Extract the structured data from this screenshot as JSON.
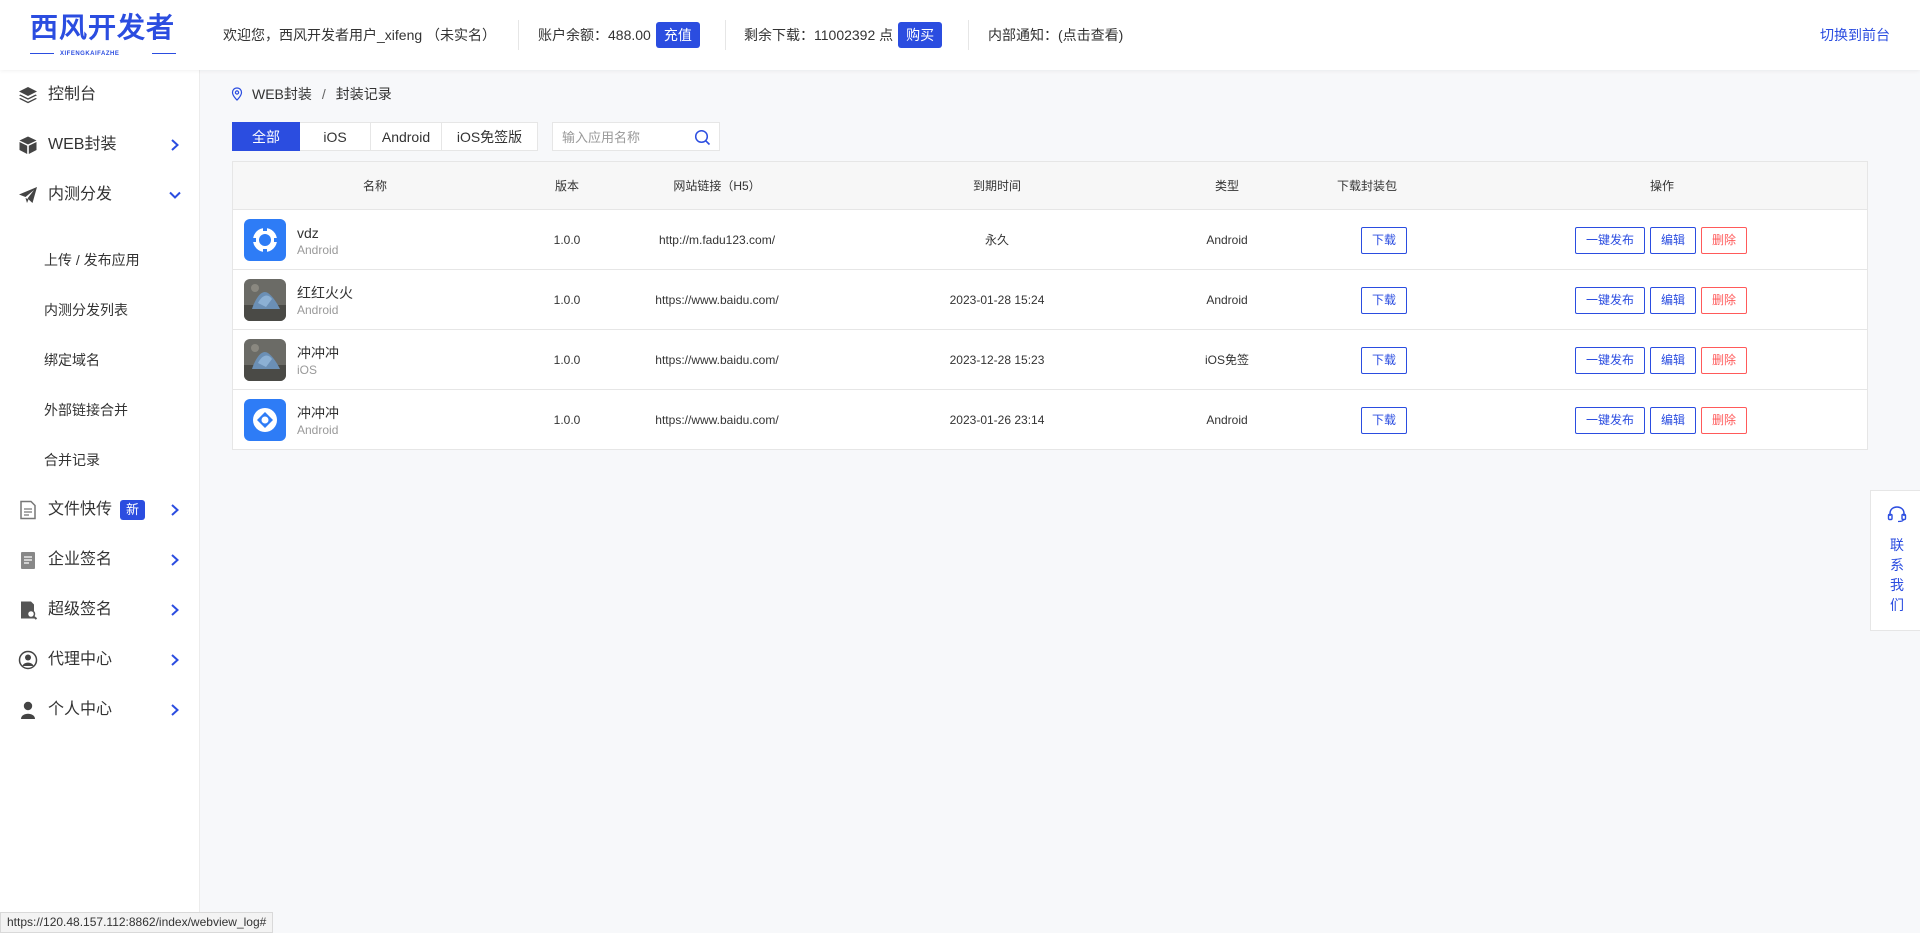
{
  "header": {
    "logo_cn": "西风开发者",
    "logo_en": "XIFENGKAIFAZHE",
    "welcome": "欢迎您，西风开发者用户_xifeng （未实名）",
    "balance_label": "账户余额：488.00",
    "recharge_button": "充值",
    "downloads_label": "剩余下载：11002392 点",
    "buy_button": "购买",
    "notice": "内部通知：(点击查看)",
    "switch_link": "切换到前台"
  },
  "sidebar": {
    "items": [
      {
        "label": "控制台",
        "icon": "layers-icon"
      },
      {
        "label": "WEB封装",
        "icon": "box-icon"
      },
      {
        "label": "内测分发",
        "icon": "paper-plane-icon"
      }
    ],
    "sub_items": [
      "上传 / 发布应用",
      "内测分发列表",
      "绑定域名",
      "外部链接合并",
      "合并记录"
    ],
    "bottom_items": [
      {
        "label": "文件快传",
        "icon": "file-transfer-icon",
        "badge": "新"
      },
      {
        "label": "企业签名",
        "icon": "document-sign-icon"
      },
      {
        "label": "超级签名",
        "icon": "super-sign-icon"
      },
      {
        "label": "代理中心",
        "icon": "agent-icon"
      },
      {
        "label": "个人中心",
        "icon": "user-icon"
      }
    ]
  },
  "breadcrumb": {
    "first": "WEB封装",
    "separator": "/",
    "current": "封装记录"
  },
  "tabs": [
    "全部",
    "iOS",
    "Android",
    "iOS免签版"
  ],
  "search": {
    "placeholder": "输入应用名称"
  },
  "table": {
    "headers": [
      "名称",
      "版本",
      "网站链接（H5）",
      "到期时间",
      "类型",
      "下载封装包",
      "操作"
    ],
    "rows": [
      {
        "name": "vdz",
        "platform": "Android",
        "version": "1.0.0",
        "url": "http://m.fadu123.com/",
        "expire": "永久",
        "type": "Android",
        "download": "下载",
        "publish": "一键发布",
        "edit": "编辑",
        "delete": "删除",
        "avatar": "gear-blue"
      },
      {
        "name": "红红火火",
        "platform": "Android",
        "version": "1.0.0",
        "url": "https://www.baidu.com/",
        "expire": "2023-01-28 15:24",
        "type": "Android",
        "download": "下载",
        "publish": "一键发布",
        "edit": "编辑",
        "delete": "删除",
        "avatar": "photo"
      },
      {
        "name": "冲冲冲",
        "platform": "iOS",
        "version": "1.0.0",
        "url": "https://www.baidu.com/",
        "expire": "2023-12-28 15:23",
        "type": "iOS免签",
        "download": "下载",
        "publish": "一键发布",
        "edit": "编辑",
        "delete": "删除",
        "avatar": "photo"
      },
      {
        "name": "冲冲冲",
        "platform": "Android",
        "version": "1.0.0",
        "url": "https://www.baidu.com/",
        "expire": "2023-01-26 23:14",
        "type": "Android",
        "download": "下载",
        "publish": "一键发布",
        "edit": "编辑",
        "delete": "删除",
        "avatar": "circle-blue"
      }
    ]
  },
  "contact": {
    "label": "联系我们",
    "chars": [
      "联",
      "系",
      "我",
      "们"
    ]
  },
  "statusbar": {
    "url": "https://120.48.157.112:8862/index/webview_log#"
  },
  "colors": {
    "accent": "#2b4de0",
    "danger": "#ff5a5a",
    "background": "#f7f8fa"
  }
}
